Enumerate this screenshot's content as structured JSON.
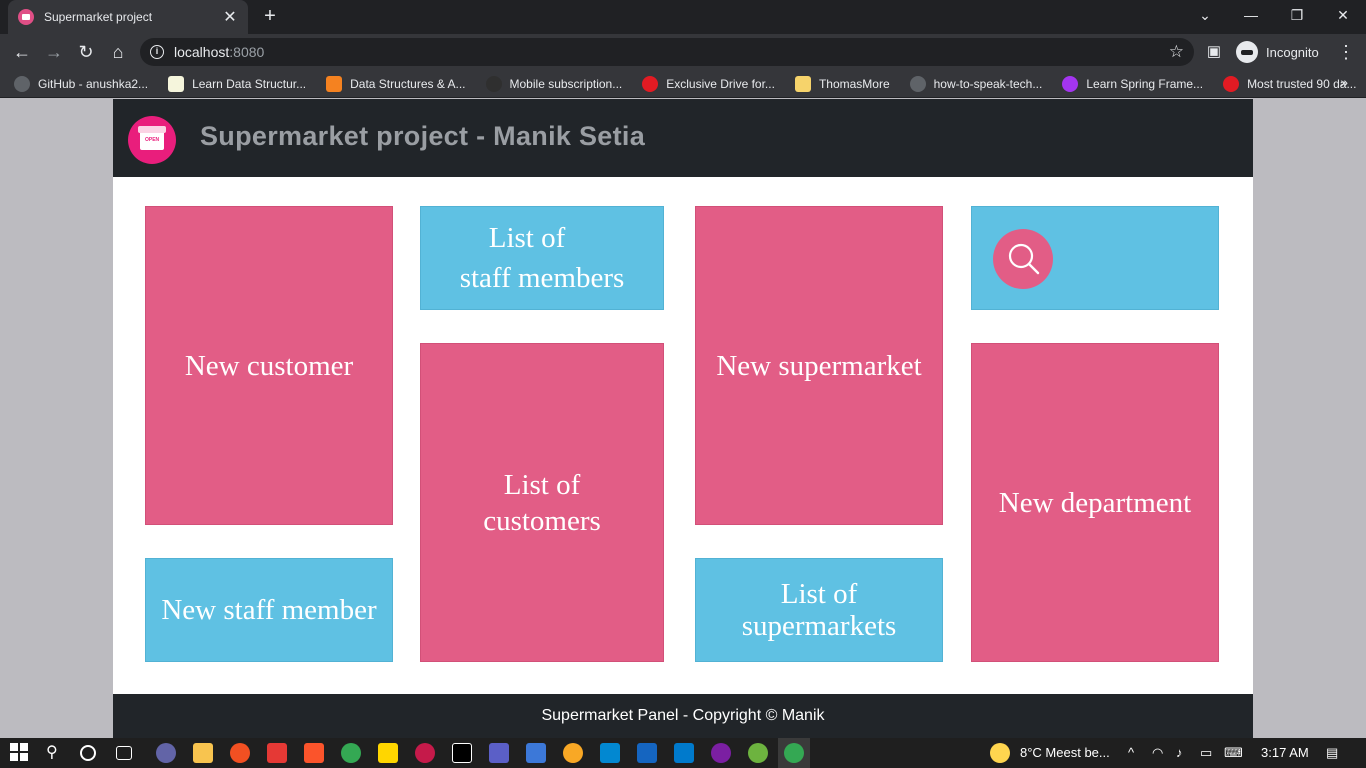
{
  "browser": {
    "tab_title": "Supermarket project",
    "url_host": "localhost",
    "url_port": ":8080",
    "incognito_label": "Incognito",
    "bookmarks": [
      {
        "label": "GitHub - anushka2...",
        "color": "#24292e"
      },
      {
        "label": "Learn Data Structur...",
        "color": "#f5f5dc"
      },
      {
        "label": "Data Structures & A...",
        "color": "#f58220"
      },
      {
        "label": "Mobile subscription...",
        "color": "#2f2f2f"
      },
      {
        "label": "Exclusive Drive for...",
        "color": "#e21b23"
      },
      {
        "label": "ThomasMore",
        "color": "#f6d36b"
      },
      {
        "label": "how-to-speak-tech...",
        "color": "#5f6368"
      },
      {
        "label": "Learn Spring Frame...",
        "color": "#a435f0"
      },
      {
        "label": "Most trusted 90 da...",
        "color": "#e21b23"
      }
    ]
  },
  "app": {
    "title": "Supermarket project - Manik Setia",
    "logo_icon": "store-open-icon",
    "footer": "Supermarket Panel - Copyright © Manik",
    "tiles": {
      "new_customer": "New customer",
      "list_staff_1": "List of",
      "list_staff_2": "staff members",
      "new_supermarket": "New supermarket",
      "search_icon": "search-icon",
      "new_staff": "New staff member",
      "list_customers_1": "List of",
      "list_customers_2": "customers",
      "list_supermarkets_1": "List of",
      "list_supermarkets_2": "supermarkets",
      "new_department": "New department"
    },
    "colors": {
      "pink": "#e25d86",
      "blue": "#5fc1e3",
      "dark": "#212529"
    }
  },
  "taskbar": {
    "weather": "8°C  Meest be...",
    "time": "3:17 AM"
  }
}
